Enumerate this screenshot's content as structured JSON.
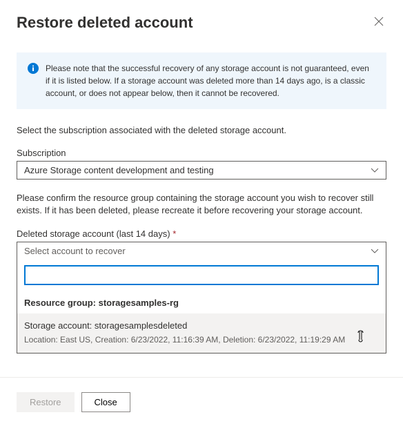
{
  "header": {
    "title": "Restore deleted account"
  },
  "info": {
    "text": "Please note that the successful recovery of any storage account is not guaranteed, even if it is listed below. If a storage account was deleted more than 14 days ago, is a classic account, or does not appear below, then it cannot be recovered."
  },
  "instructions": {
    "subscription": "Select the subscription associated with the deleted storage account.",
    "resourceGroup": "Please confirm the resource group containing the storage account you wish to recover still exists. If it has been deleted, please recreate it before recovering your storage account."
  },
  "fields": {
    "subscription": {
      "label": "Subscription",
      "value": "Azure Storage content development and testing"
    },
    "deletedAccount": {
      "label": "Deleted storage account (last 14 days)",
      "placeholder": "Select account to recover"
    }
  },
  "dropdown": {
    "groupHeader": "Resource group: storagesamples-rg",
    "option": {
      "title": "Storage account: storagesamplesdeleted",
      "details": "Location: East US, Creation: 6/23/2022, 11:16:39 AM, Deletion: 6/23/2022, 11:19:29 AM"
    }
  },
  "buttons": {
    "restore": "Restore",
    "close": "Close"
  }
}
